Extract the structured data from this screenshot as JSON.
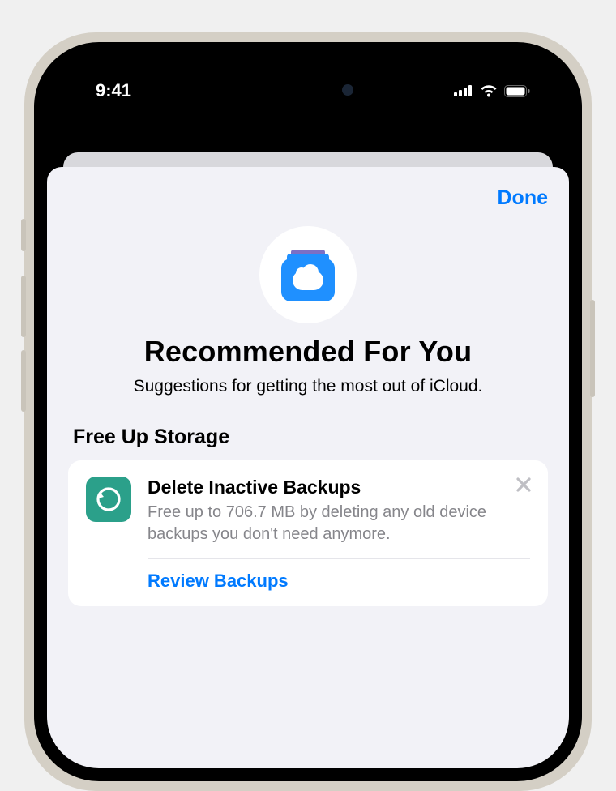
{
  "status": {
    "time": "9:41"
  },
  "sheet": {
    "done_label": "Done",
    "title": "Recommended For You",
    "subtitle": "Suggestions for getting the most out of iCloud."
  },
  "section": {
    "header": "Free Up Storage"
  },
  "card": {
    "title": "Delete Inactive Backups",
    "description": "Free up to 706.7 MB by deleting any old device backups you don't need anymore.",
    "action_label": "Review Backups"
  }
}
